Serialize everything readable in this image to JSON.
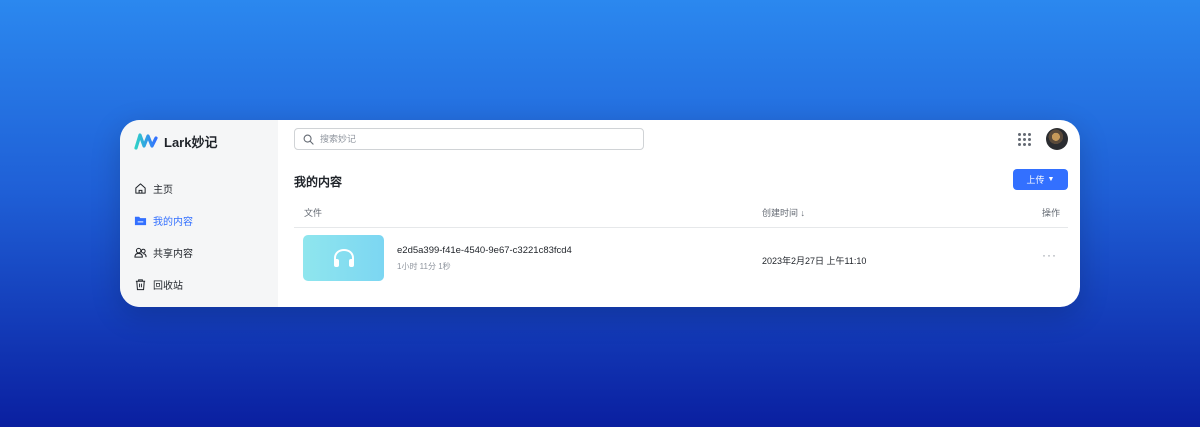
{
  "brand": {
    "name": "Lark妙记"
  },
  "sidebar": {
    "items": [
      {
        "label": "主页",
        "icon": "home-icon",
        "active": false
      },
      {
        "label": "我的内容",
        "icon": "folder-icon",
        "active": true
      },
      {
        "label": "共享内容",
        "icon": "users-icon",
        "active": false
      },
      {
        "label": "回收站",
        "icon": "trash-icon",
        "active": false
      }
    ]
  },
  "search": {
    "placeholder": "搜索妙记",
    "value": ""
  },
  "header": {
    "title": "我的内容",
    "upload_label": "上传"
  },
  "table": {
    "columns": {
      "file": "文件",
      "created": "创建时间",
      "sort_indicator": "↓",
      "actions": "操作"
    },
    "rows": [
      {
        "name": "e2d5a399-f41e-4540-9e67-c3221c83fcd4",
        "duration": "1小时 11分 1秒",
        "created": "2023年2月27日 上午11:10",
        "more": "···",
        "thumb_icon": "headphones-icon"
      }
    ]
  },
  "colors": {
    "accent": "#3370ff",
    "background_top": "#2b88ef",
    "background_bottom": "#0a1fa0"
  }
}
